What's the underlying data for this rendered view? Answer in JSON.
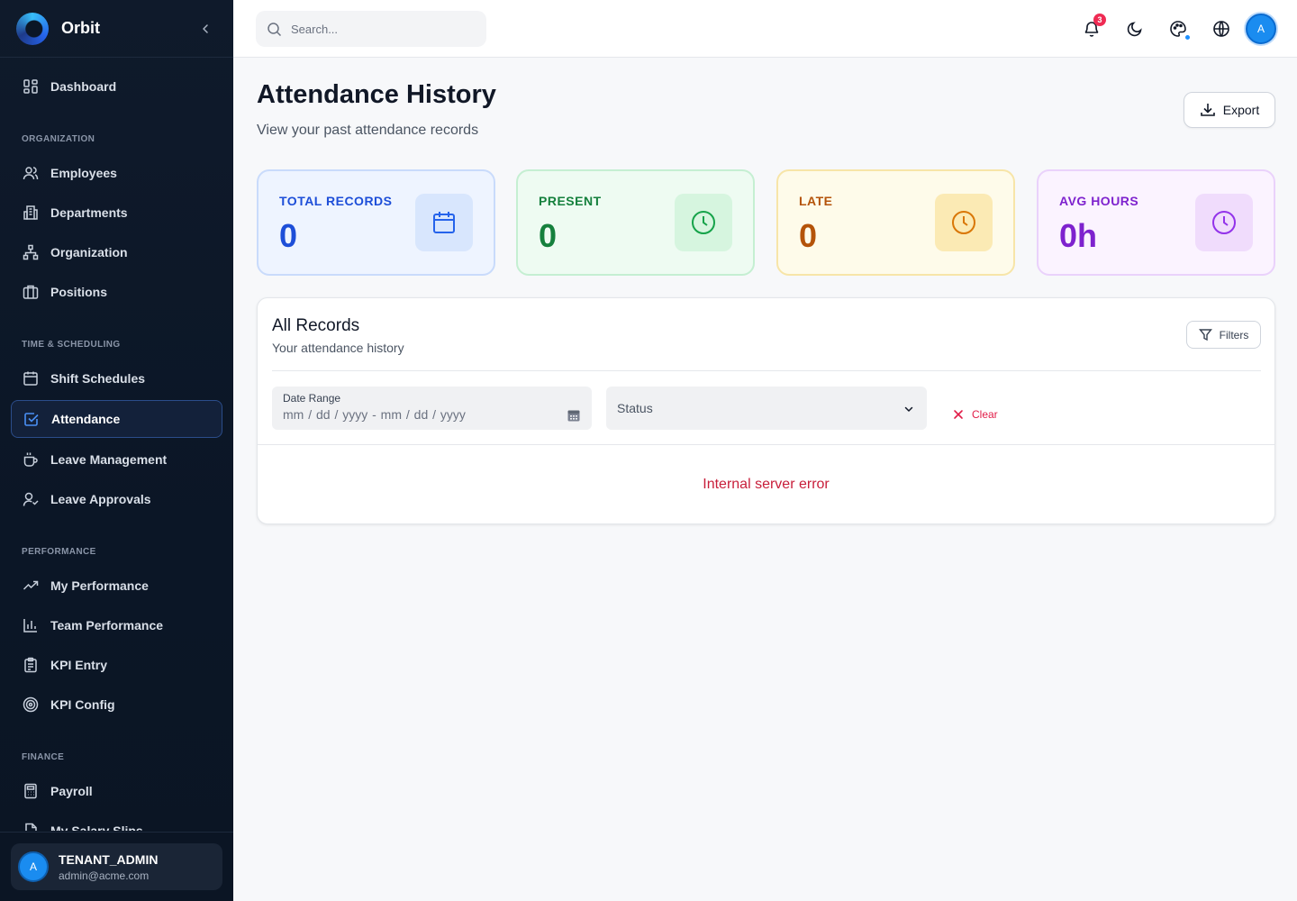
{
  "app": {
    "name": "Orbit"
  },
  "sidebar": {
    "items": [
      {
        "id": "dashboard",
        "label": "Dashboard",
        "icon": "dashboard-icon"
      },
      {
        "id": "employees",
        "label": "Employees",
        "icon": "users-icon"
      },
      {
        "id": "departments",
        "label": "Departments",
        "icon": "building-icon"
      },
      {
        "id": "organization",
        "label": "Organization",
        "icon": "org-chart-icon"
      },
      {
        "id": "positions",
        "label": "Positions",
        "icon": "briefcase-icon"
      },
      {
        "id": "shift-schedules",
        "label": "Shift Schedules",
        "icon": "calendar-icon"
      },
      {
        "id": "attendance",
        "label": "Attendance",
        "icon": "check-square-icon",
        "active": true
      },
      {
        "id": "leave-management",
        "label": "Leave Management",
        "icon": "coffee-icon"
      },
      {
        "id": "leave-approvals",
        "label": "Leave Approvals",
        "icon": "user-check-icon"
      },
      {
        "id": "my-performance",
        "label": "My Performance",
        "icon": "trending-up-icon"
      },
      {
        "id": "team-performance",
        "label": "Team Performance",
        "icon": "bar-chart-icon"
      },
      {
        "id": "kpi-entry",
        "label": "KPI Entry",
        "icon": "clipboard-icon"
      },
      {
        "id": "kpi-config",
        "label": "KPI Config",
        "icon": "target-icon"
      },
      {
        "id": "payroll",
        "label": "Payroll",
        "icon": "calculator-icon"
      },
      {
        "id": "my-salary-slips",
        "label": "My Salary Slips",
        "icon": "file-icon"
      }
    ],
    "sections": {
      "organization": "ORGANIZATION",
      "time": "TIME & SCHEDULING",
      "performance": "PERFORMANCE",
      "finance": "FINANCE"
    },
    "user": {
      "initial": "A",
      "role": "TENANT_ADMIN",
      "email": "admin@acme.com"
    }
  },
  "topbar": {
    "search_placeholder": "Search...",
    "notification_count": "3",
    "avatar_initial": "A"
  },
  "page": {
    "title": "Attendance History",
    "subtitle": "View your past attendance records",
    "export_label": "Export"
  },
  "stats": [
    {
      "label": "TOTAL RECORDS",
      "value": "0",
      "icon": "calendar-icon",
      "color": "#1d4ed8"
    },
    {
      "label": "PRESENT",
      "value": "0",
      "icon": "clock-icon",
      "color": "#15803d"
    },
    {
      "label": "LATE",
      "value": "0",
      "icon": "clock-icon",
      "color": "#b45309"
    },
    {
      "label": "AVG HOURS",
      "value": "0h",
      "icon": "clock-icon",
      "color": "#7e22ce"
    }
  ],
  "records": {
    "title": "All Records",
    "subtitle": "Your attendance history",
    "filters_label": "Filters",
    "date_range_label": "Date Range",
    "date_range_value": "mm / dd / yyyy  -  mm / dd / yyyy",
    "status_placeholder": "Status",
    "clear_label": "Clear",
    "error_message": "Internal server error"
  }
}
